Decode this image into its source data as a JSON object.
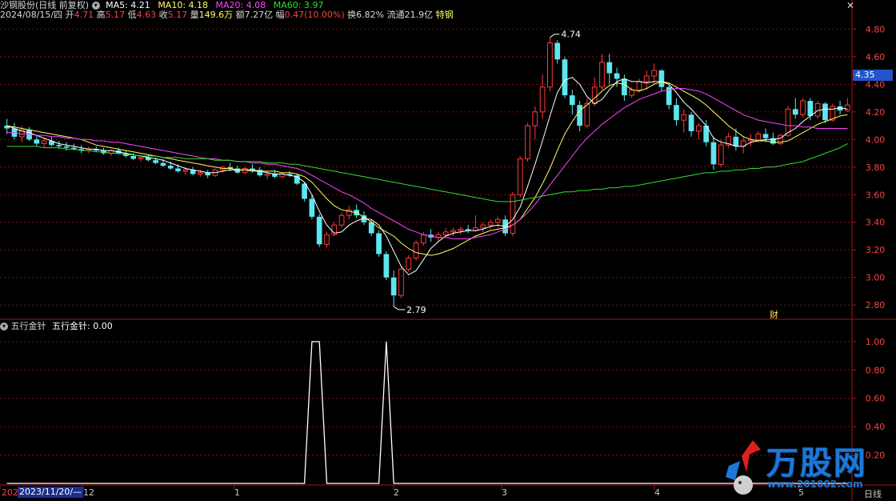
{
  "header": {
    "stock_title": "沙钢股份(日线 前复权)",
    "ma5": "MA5: 4.21",
    "ma10": "MA10: 4.18",
    "ma20": "MA20: 4.08",
    "ma60": "MA60: 3.97",
    "date": "2024/08/15/四",
    "open_label": "开",
    "open_value": "4.71",
    "high_label": "高",
    "high_value": "5.17",
    "low_label": "低",
    "low_value": "4.63",
    "close_label": "收",
    "close_value": "5.17",
    "vol_label": "量",
    "vol_value": "149.6万",
    "amount_label": "额",
    "amount_value": "7.27亿",
    "change_label": "幅",
    "change_value": "0.47(10.00%)",
    "turnover": "换6.82%",
    "float": "流通21.9亿",
    "tag": "特钢"
  },
  "indicator": {
    "name": "五行金针",
    "value_label": "五行金针: 0.00"
  },
  "price_axis": [
    "4.80",
    "4.60",
    "4.40",
    "4.20",
    "4.00",
    "3.80",
    "3.60",
    "3.40",
    "3.20",
    "3.00",
    "2.80"
  ],
  "indicator_axis": [
    "1.00",
    "0.80",
    "0.60",
    "0.40",
    "0.20"
  ],
  "current_price": "4.35",
  "annotations": {
    "high": "4.74",
    "low": "2.79",
    "cai": "财"
  },
  "x_axis": {
    "left_label": "202",
    "date_box": "2023/11/20/—",
    "labels": [
      "12",
      "1",
      "2",
      "3",
      "4",
      "5"
    ],
    "right_label": "日线"
  },
  "watermark": {
    "brand": "万股网",
    "url": "www.201082.com"
  },
  "colors": {
    "up": "#ff3a3a",
    "down": "#5ce6f0",
    "ma5": "#ffffff",
    "ma10": "#ffff66",
    "ma20": "#ff44ff",
    "ma60": "#33dd33",
    "grid": "#7a1010",
    "axis": "#b01010"
  },
  "chart_data": {
    "type": "candlestick",
    "candles": [
      [
        4.1,
        4.15,
        4.04,
        4.08
      ],
      [
        4.08,
        4.12,
        4.0,
        4.02
      ],
      [
        4.02,
        4.1,
        3.98,
        4.07
      ],
      [
        4.07,
        4.09,
        3.99,
        4.0
      ],
      [
        4.0,
        4.03,
        3.95,
        3.97
      ],
      [
        3.97,
        4.01,
        3.94,
        3.99
      ],
      [
        3.99,
        4.02,
        3.95,
        3.96
      ],
      [
        3.96,
        3.99,
        3.93,
        3.95
      ],
      [
        3.95,
        3.98,
        3.92,
        3.94
      ],
      [
        3.94,
        3.97,
        3.92,
        3.93
      ],
      [
        3.93,
        3.96,
        3.9,
        3.92
      ],
      [
        3.92,
        3.95,
        3.9,
        3.93
      ],
      [
        3.93,
        3.95,
        3.91,
        3.92
      ],
      [
        3.92,
        3.94,
        3.89,
        3.9
      ],
      [
        3.9,
        3.93,
        3.88,
        3.92
      ],
      [
        3.92,
        3.94,
        3.89,
        3.9
      ],
      [
        3.9,
        3.92,
        3.87,
        3.88
      ],
      [
        3.88,
        3.9,
        3.85,
        3.86
      ],
      [
        3.86,
        3.89,
        3.84,
        3.87
      ],
      [
        3.87,
        3.89,
        3.84,
        3.85
      ],
      [
        3.85,
        3.87,
        3.82,
        3.83
      ],
      [
        3.83,
        3.86,
        3.8,
        3.81
      ],
      [
        3.81,
        3.84,
        3.78,
        3.79
      ],
      [
        3.79,
        3.82,
        3.76,
        3.77
      ],
      [
        3.77,
        3.8,
        3.74,
        3.78
      ],
      [
        3.78,
        3.8,
        3.74,
        3.75
      ],
      [
        3.75,
        3.78,
        3.73,
        3.76
      ],
      [
        3.76,
        3.78,
        3.72,
        3.74
      ],
      [
        3.74,
        3.79,
        3.73,
        3.78
      ],
      [
        3.78,
        3.81,
        3.76,
        3.8
      ],
      [
        3.8,
        3.83,
        3.77,
        3.79
      ],
      [
        3.79,
        3.81,
        3.75,
        3.76
      ],
      [
        3.76,
        3.8,
        3.75,
        3.79
      ],
      [
        3.79,
        3.82,
        3.76,
        3.78
      ],
      [
        3.78,
        3.8,
        3.73,
        3.74
      ],
      [
        3.74,
        3.77,
        3.71,
        3.75
      ],
      [
        3.75,
        3.78,
        3.72,
        3.73
      ],
      [
        3.73,
        3.76,
        3.72,
        3.75
      ],
      [
        3.75,
        3.77,
        3.73,
        3.74
      ],
      [
        3.74,
        3.75,
        3.67,
        3.68
      ],
      [
        3.68,
        3.69,
        3.55,
        3.57
      ],
      [
        3.57,
        3.6,
        3.42,
        3.44
      ],
      [
        3.44,
        3.46,
        3.22,
        3.24
      ],
      [
        3.24,
        3.33,
        3.22,
        3.31
      ],
      [
        3.31,
        3.4,
        3.3,
        3.38
      ],
      [
        3.38,
        3.47,
        3.36,
        3.45
      ],
      [
        3.45,
        3.52,
        3.42,
        3.49
      ],
      [
        3.49,
        3.53,
        3.43,
        3.45
      ],
      [
        3.45,
        3.48,
        3.38,
        3.4
      ],
      [
        3.4,
        3.42,
        3.3,
        3.32
      ],
      [
        3.32,
        3.34,
        3.15,
        3.17
      ],
      [
        3.17,
        3.19,
        2.98,
        3.0
      ],
      [
        3.0,
        3.05,
        2.79,
        2.87
      ],
      [
        2.87,
        3.08,
        2.85,
        3.06
      ],
      [
        3.06,
        3.16,
        3.04,
        3.14
      ],
      [
        3.14,
        3.27,
        3.12,
        3.25
      ],
      [
        3.25,
        3.33,
        3.23,
        3.31
      ],
      [
        3.31,
        3.35,
        3.26,
        3.29
      ],
      [
        3.29,
        3.33,
        3.26,
        3.31
      ],
      [
        3.31,
        3.36,
        3.29,
        3.33
      ],
      [
        3.33,
        3.36,
        3.3,
        3.34
      ],
      [
        3.34,
        3.37,
        3.31,
        3.35
      ],
      [
        3.35,
        3.38,
        3.32,
        3.34
      ],
      [
        3.34,
        3.45,
        3.33,
        3.36
      ],
      [
        3.36,
        3.4,
        3.33,
        3.38
      ],
      [
        3.38,
        3.42,
        3.35,
        3.4
      ],
      [
        3.4,
        3.44,
        3.36,
        3.42
      ],
      [
        3.42,
        3.45,
        3.3,
        3.32
      ],
      [
        3.32,
        3.62,
        3.3,
        3.6
      ],
      [
        3.6,
        3.88,
        3.58,
        3.86
      ],
      [
        3.86,
        4.12,
        3.84,
        4.1
      ],
      [
        4.1,
        4.24,
        4.0,
        4.2
      ],
      [
        4.2,
        4.47,
        4.15,
        4.38
      ],
      [
        4.38,
        4.74,
        4.35,
        4.7
      ],
      [
        4.7,
        4.72,
        4.55,
        4.58
      ],
      [
        4.58,
        4.6,
        4.3,
        4.32
      ],
      [
        4.32,
        4.36,
        4.18,
        4.25
      ],
      [
        4.25,
        4.28,
        4.06,
        4.1
      ],
      [
        4.1,
        4.3,
        4.08,
        4.26
      ],
      [
        4.26,
        4.45,
        4.24,
        4.38
      ],
      [
        4.38,
        4.62,
        4.36,
        4.56
      ],
      [
        4.56,
        4.62,
        4.4,
        4.48
      ],
      [
        4.48,
        4.52,
        4.38,
        4.44
      ],
      [
        4.44,
        4.47,
        4.28,
        4.32
      ],
      [
        4.32,
        4.38,
        4.3,
        4.36
      ],
      [
        4.36,
        4.44,
        4.34,
        4.42
      ],
      [
        4.42,
        4.5,
        4.36,
        4.46
      ],
      [
        4.46,
        4.55,
        4.4,
        4.5
      ],
      [
        4.5,
        4.51,
        4.35,
        4.38
      ],
      [
        4.38,
        4.4,
        4.22,
        4.25
      ],
      [
        4.25,
        4.3,
        4.1,
        4.14
      ],
      [
        4.14,
        4.22,
        4.05,
        4.18
      ],
      [
        4.18,
        4.2,
        4.02,
        4.06
      ],
      [
        4.06,
        4.12,
        4.0,
        4.1
      ],
      [
        4.1,
        4.14,
        3.95,
        3.98
      ],
      [
        3.98,
        4.02,
        3.78,
        3.82
      ],
      [
        3.82,
        4.0,
        3.8,
        3.96
      ],
      [
        3.96,
        4.05,
        3.94,
        4.02
      ],
      [
        4.02,
        4.08,
        3.92,
        3.95
      ],
      [
        3.95,
        4.02,
        3.9,
        3.99
      ],
      [
        3.99,
        4.04,
        3.95,
        4.0
      ],
      [
        4.0,
        4.06,
        3.98,
        4.04
      ],
      [
        4.04,
        4.08,
        3.98,
        4.01
      ],
      [
        4.01,
        4.05,
        3.96,
        3.97
      ],
      [
        3.97,
        4.04,
        3.96,
        4.03
      ],
      [
        4.03,
        4.24,
        4.02,
        4.22
      ],
      [
        4.22,
        4.3,
        4.15,
        4.18
      ],
      [
        4.18,
        4.3,
        4.16,
        4.28
      ],
      [
        4.28,
        4.3,
        4.14,
        4.17
      ],
      [
        4.17,
        4.28,
        4.15,
        4.26
      ],
      [
        4.26,
        4.27,
        4.12,
        4.14
      ],
      [
        4.14,
        4.26,
        4.13,
        4.24
      ],
      [
        4.24,
        4.28,
        4.18,
        4.21
      ],
      [
        4.21,
        4.3,
        4.2,
        4.25
      ]
    ],
    "ma_series": [
      {
        "name": "MA5",
        "values": [
          4.1,
          4.08,
          4.06,
          4.05,
          4.03,
          4.01,
          3.99,
          3.97,
          3.96,
          3.95,
          3.94,
          3.93,
          3.93,
          3.92,
          3.92,
          3.91,
          3.9,
          3.89,
          3.88,
          3.87,
          3.86,
          3.85,
          3.83,
          3.81,
          3.79,
          3.78,
          3.77,
          3.76,
          3.76,
          3.77,
          3.78,
          3.78,
          3.78,
          3.78,
          3.77,
          3.76,
          3.75,
          3.75,
          3.74,
          3.73,
          3.69,
          3.6,
          3.48,
          3.38,
          3.32,
          3.33,
          3.38,
          3.41,
          3.43,
          3.42,
          3.38,
          3.3,
          3.19,
          3.08,
          3.02,
          3.05,
          3.13,
          3.21,
          3.26,
          3.3,
          3.32,
          3.33,
          3.34,
          3.34,
          3.35,
          3.37,
          3.38,
          3.37,
          3.42,
          3.51,
          3.66,
          3.82,
          3.99,
          4.17,
          4.34,
          4.43,
          4.45,
          4.4,
          4.31,
          4.26,
          4.29,
          4.36,
          4.42,
          4.44,
          4.42,
          4.42,
          4.41,
          4.42,
          4.42,
          4.4,
          4.34,
          4.27,
          4.22,
          4.16,
          4.1,
          4.01,
          3.98,
          3.97,
          3.95,
          3.95,
          3.98,
          3.99,
          4.0,
          4.0,
          4.01,
          4.05,
          4.08,
          4.13,
          4.17,
          4.21,
          4.22,
          4.22,
          4.23,
          4.22
        ]
      },
      {
        "name": "MA10",
        "values": [
          4.1,
          4.09,
          4.08,
          4.07,
          4.06,
          4.05,
          4.04,
          4.03,
          4.02,
          4.01,
          4.0,
          3.98,
          3.96,
          3.95,
          3.94,
          3.93,
          3.92,
          3.91,
          3.9,
          3.89,
          3.88,
          3.87,
          3.86,
          3.85,
          3.84,
          3.83,
          3.82,
          3.81,
          3.8,
          3.79,
          3.79,
          3.78,
          3.78,
          3.77,
          3.77,
          3.77,
          3.77,
          3.76,
          3.76,
          3.75,
          3.73,
          3.69,
          3.63,
          3.57,
          3.52,
          3.49,
          3.48,
          3.47,
          3.44,
          3.4,
          3.36,
          3.33,
          3.3,
          3.25,
          3.21,
          3.18,
          3.17,
          3.16,
          3.17,
          3.19,
          3.21,
          3.24,
          3.27,
          3.3,
          3.32,
          3.34,
          3.35,
          3.36,
          3.38,
          3.42,
          3.5,
          3.58,
          3.68,
          3.79,
          3.92,
          4.04,
          4.13,
          4.21,
          4.25,
          4.3,
          4.35,
          4.39,
          4.41,
          4.4,
          4.36,
          4.35,
          4.37,
          4.4,
          4.42,
          4.41,
          4.38,
          4.35,
          4.32,
          4.29,
          4.25,
          4.2,
          4.15,
          4.1,
          4.06,
          4.02,
          4.0,
          3.99,
          3.99,
          3.98,
          3.98,
          3.99,
          4.02,
          4.05,
          4.08,
          4.11,
          4.13,
          4.15,
          4.17,
          4.18
        ]
      },
      {
        "name": "MA20",
        "values": [
          4.05,
          4.05,
          4.04,
          4.04,
          4.03,
          4.03,
          4.02,
          4.02,
          4.01,
          4.01,
          4.0,
          4.0,
          3.99,
          3.99,
          3.98,
          3.98,
          3.97,
          3.96,
          3.95,
          3.94,
          3.93,
          3.92,
          3.91,
          3.9,
          3.89,
          3.88,
          3.87,
          3.86,
          3.86,
          3.85,
          3.85,
          3.84,
          3.84,
          3.83,
          3.83,
          3.82,
          3.82,
          3.81,
          3.8,
          3.79,
          3.77,
          3.74,
          3.71,
          3.68,
          3.65,
          3.62,
          3.6,
          3.57,
          3.54,
          3.5,
          3.47,
          3.44,
          3.41,
          3.38,
          3.35,
          3.33,
          3.31,
          3.3,
          3.29,
          3.29,
          3.28,
          3.28,
          3.28,
          3.29,
          3.3,
          3.31,
          3.33,
          3.35,
          3.38,
          3.42,
          3.47,
          3.53,
          3.6,
          3.67,
          3.74,
          3.81,
          3.88,
          3.95,
          4.01,
          4.06,
          4.11,
          4.15,
          4.19,
          4.23,
          4.26,
          4.29,
          4.31,
          4.33,
          4.35,
          4.36,
          4.37,
          4.37,
          4.36,
          4.35,
          4.33,
          4.3,
          4.27,
          4.24,
          4.21,
          4.18,
          4.16,
          4.14,
          4.13,
          4.12,
          4.11,
          4.1,
          4.1,
          4.09,
          4.09,
          4.08,
          4.08,
          4.08,
          4.08,
          4.08
        ]
      },
      {
        "name": "MA60",
        "values": [
          3.95,
          3.95,
          3.95,
          3.95,
          3.95,
          3.94,
          3.94,
          3.94,
          3.93,
          3.93,
          3.92,
          3.92,
          3.91,
          3.91,
          3.9,
          3.9,
          3.89,
          3.89,
          3.88,
          3.88,
          3.88,
          3.87,
          3.87,
          3.87,
          3.86,
          3.86,
          3.86,
          3.86,
          3.85,
          3.85,
          3.85,
          3.84,
          3.84,
          3.84,
          3.84,
          3.83,
          3.83,
          3.83,
          3.82,
          3.82,
          3.81,
          3.8,
          3.79,
          3.78,
          3.77,
          3.76,
          3.75,
          3.74,
          3.73,
          3.72,
          3.71,
          3.7,
          3.69,
          3.68,
          3.67,
          3.66,
          3.65,
          3.64,
          3.63,
          3.62,
          3.61,
          3.6,
          3.59,
          3.58,
          3.57,
          3.56,
          3.55,
          3.55,
          3.55,
          3.56,
          3.57,
          3.58,
          3.59,
          3.6,
          3.61,
          3.62,
          3.62,
          3.63,
          3.63,
          3.64,
          3.64,
          3.65,
          3.65,
          3.66,
          3.66,
          3.67,
          3.68,
          3.69,
          3.7,
          3.71,
          3.72,
          3.73,
          3.74,
          3.75,
          3.76,
          3.76,
          3.77,
          3.77,
          3.78,
          3.78,
          3.79,
          3.79,
          3.8,
          3.8,
          3.81,
          3.82,
          3.83,
          3.84,
          3.86,
          3.88,
          3.9,
          3.92,
          3.94,
          3.97
        ]
      }
    ],
    "indicator_series": {
      "name": "五行金针",
      "values": [
        0,
        0,
        0,
        0,
        0,
        0,
        0,
        0,
        0,
        0,
        0,
        0,
        0,
        0,
        0,
        0,
        0,
        0,
        0,
        0,
        0,
        0,
        0,
        0,
        0,
        0,
        0,
        0,
        0,
        0,
        0,
        0,
        0,
        0,
        0,
        0,
        0,
        0,
        0,
        0,
        0,
        1,
        1,
        0,
        0,
        0,
        0,
        0,
        0,
        0,
        0,
        1,
        0,
        0,
        0,
        0,
        0,
        0,
        0,
        0,
        0,
        0,
        0,
        0,
        0,
        0,
        0,
        0,
        0,
        0,
        0,
        0,
        0,
        0,
        0,
        0,
        0,
        0,
        0,
        0,
        0,
        0,
        0,
        0,
        0,
        0,
        0,
        0,
        0,
        0,
        0,
        0,
        0,
        0,
        0,
        0,
        0,
        0,
        0,
        0,
        0,
        0,
        0,
        0,
        0,
        0,
        0,
        0,
        0,
        0,
        0,
        0,
        0,
        0
      ]
    },
    "ylim": [
      2.72,
      4.86
    ],
    "indicator_ylim": [
      0,
      1.05
    ]
  }
}
